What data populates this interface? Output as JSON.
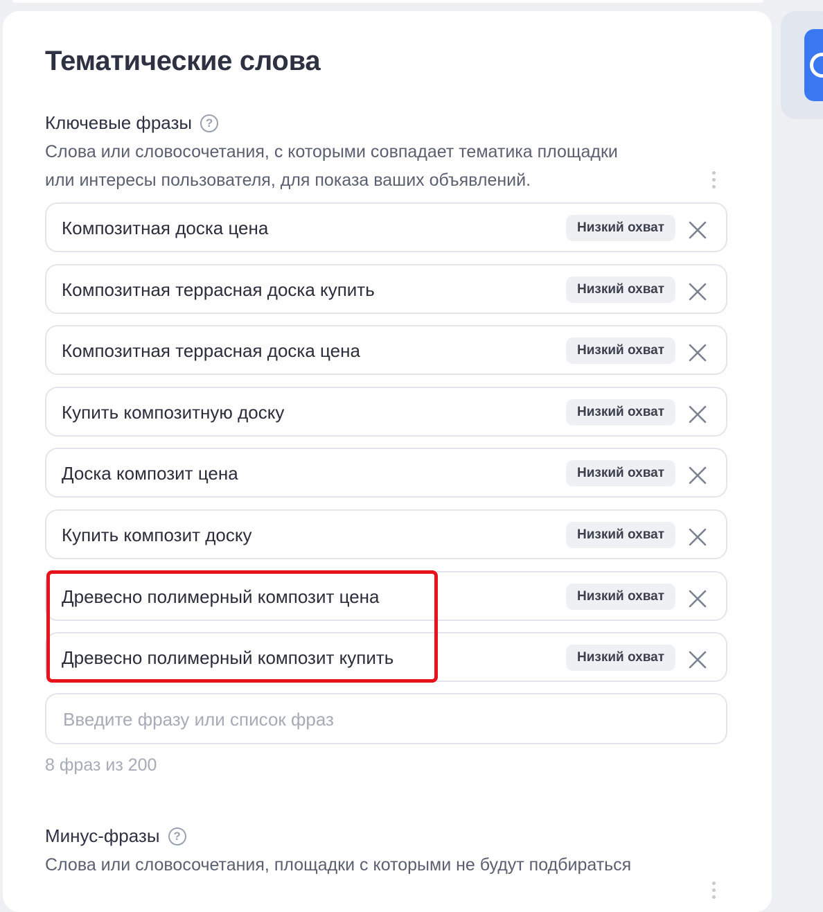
{
  "page": {
    "title": "Тематические слова"
  },
  "key_phrases": {
    "label": "Ключевые фразы",
    "help": "?",
    "description_line1": "Слова или словосочетания, с которыми совпадает тематика площадки",
    "description_line2": "или интересы пользователя, для показа ваших объявлений.",
    "items": [
      {
        "text": "Композитная доска цена",
        "badge": "Низкий охват"
      },
      {
        "text": "Композитная террасная доска купить",
        "badge": "Низкий охват"
      },
      {
        "text": "Композитная террасная доска цена",
        "badge": "Низкий охват"
      },
      {
        "text": "Купить композитную доску",
        "badge": "Низкий охват"
      },
      {
        "text": "Доска композит цена",
        "badge": "Низкий охват"
      },
      {
        "text": "Купить композит доску",
        "badge": "Низкий охват"
      },
      {
        "text": "Древесно полимерный композит цена",
        "badge": "Низкий охват"
      },
      {
        "text": "Древесно полимерный композит купить",
        "badge": "Низкий охват"
      }
    ],
    "input_placeholder": "Введите фразу или список фраз",
    "counter": "8 фраз из 200"
  },
  "minus_phrases": {
    "label": "Минус-фразы",
    "help": "?",
    "description_line1": "Слова или словосочетания, площадки с которыми не будут подбираться"
  },
  "colors": {
    "highlight_border": "#e8131a",
    "badge_bg": "#eef0f3",
    "accent_blue": "#3a78f2"
  },
  "icons": {
    "remove": "close-icon",
    "help": "question-circle-icon",
    "more": "kebab-menu-icon"
  }
}
